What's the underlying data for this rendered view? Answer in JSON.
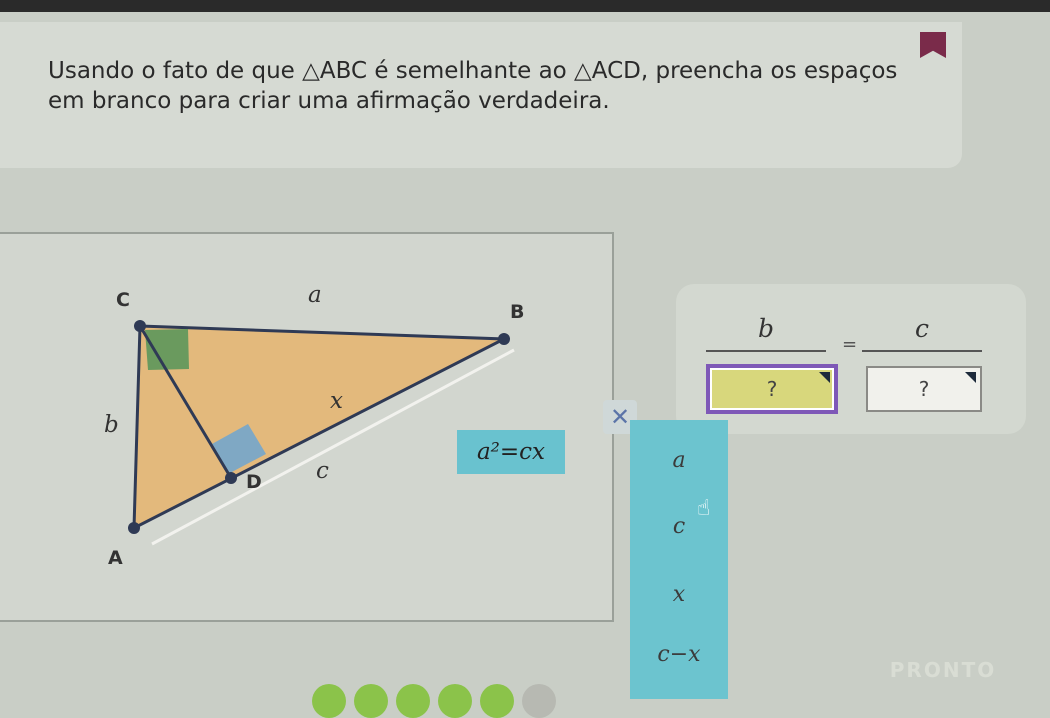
{
  "question": {
    "text": "Usando o fato de que △ABC é semelhante ao △ACD, preencha os espaços em branco para criar uma afirmação verdadeira."
  },
  "diagram": {
    "vertex_labels": {
      "C": "C",
      "B": "B",
      "D": "D",
      "A": "A"
    },
    "side_labels": {
      "a": "a",
      "b": "b",
      "x": "x",
      "c": "c"
    },
    "formula": "a²=cx",
    "colors": {
      "triangle_fill": "#e3b97c",
      "right_angle_green": "#6a9a5e",
      "right_angle_blue": "#7fa8c4",
      "formula_bg": "#69c2cf"
    }
  },
  "equation": {
    "left_numerator": "b",
    "right_numerator": "c",
    "equals": "=",
    "left_blank": "?",
    "right_blank": "?"
  },
  "answer_panel": {
    "close_symbol": "✕",
    "options": [
      "a",
      "c",
      "x",
      "c−x"
    ]
  },
  "footer": {
    "done_label": "PRONTO"
  },
  "progress": {
    "completed": 5,
    "total": 6
  },
  "colors": {
    "accent_purple": "#7e58b7",
    "progress_green": "#8bc34a",
    "panel_teal": "#6cc4cf"
  }
}
